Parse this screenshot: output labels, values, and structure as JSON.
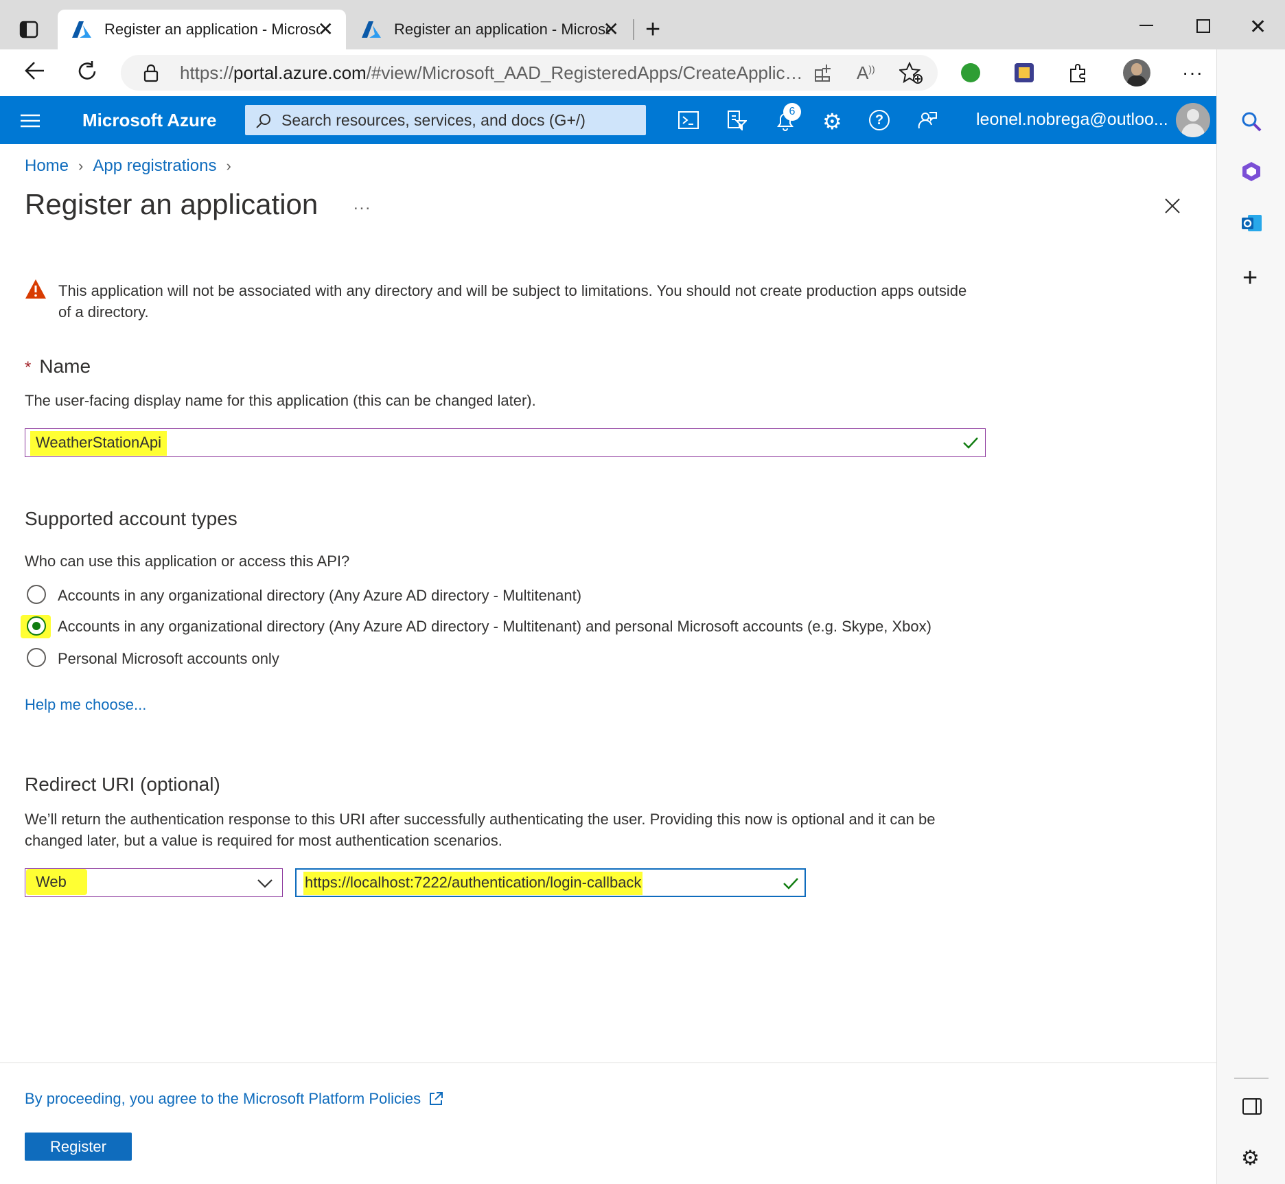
{
  "browser": {
    "tabs": [
      {
        "title": "Register an application - Microsoft Azure",
        "active": true
      },
      {
        "title": "Register an application - Microsoft Azure",
        "active": false
      }
    ],
    "url_prefix": "https://",
    "url_domain": "portal.azure.com",
    "url_rest": "/#view/Microsoft_AAD_RegisteredApps/CreateApplication..."
  },
  "azure_header": {
    "brand": "Microsoft Azure",
    "search_placeholder": "Search resources, services, and docs (G+/)",
    "notification_count": "6",
    "user": "leonel.nobrega@outloo..."
  },
  "breadcrumb": [
    "Home",
    "App registrations"
  ],
  "page": {
    "title": "Register an application",
    "more": "...",
    "warning": "This application will not be associated with any directory and will be subject to limitations. You should not create production apps outside of a directory.",
    "name": {
      "required_mark": "*",
      "label": "Name",
      "description": "The user-facing display name for this application (this can be changed later).",
      "value": "WeatherStationApi"
    },
    "account_types": {
      "title": "Supported account types",
      "question": "Who can use this application or access this API?",
      "options": [
        {
          "label": "Accounts in any organizational directory (Any Azure AD directory - Multitenant)",
          "selected": false
        },
        {
          "label": "Accounts in any organizational directory (Any Azure AD directory - Multitenant) and personal Microsoft accounts (e.g. Skype, Xbox)",
          "selected": true
        },
        {
          "label": "Personal Microsoft accounts only",
          "selected": false
        }
      ],
      "help_link": "Help me choose..."
    },
    "redirect": {
      "title": "Redirect URI (optional)",
      "description": "We’ll return the authentication response to this URI after successfully authenticating the user. Providing this now is optional and it can be changed later, but a value is required for most authentication scenarios.",
      "platform": "Web",
      "uri": "https://localhost:7222/authentication/login-callback"
    },
    "policy_link": "By proceeding, you agree to the Microsoft Platform Policies",
    "register_label": "Register"
  },
  "colors": {
    "azure_blue": "#0078d4",
    "link": "#0f6cbd",
    "highlight": "#ffff33",
    "success_green": "#107c10",
    "warning_orange": "#d83b01"
  }
}
